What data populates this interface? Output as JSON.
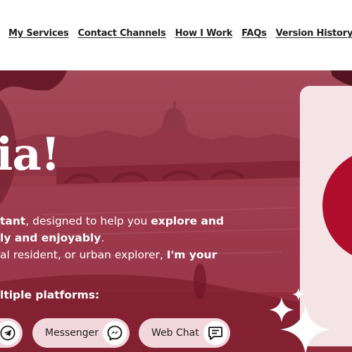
{
  "nav": {
    "items": [
      {
        "label": "My Services"
      },
      {
        "label": "Contact Channels"
      },
      {
        "label": "How I Work"
      },
      {
        "label": "FAQs"
      },
      {
        "label": "Version History"
      }
    ]
  },
  "hero": {
    "title": "ia!",
    "intro": {
      "l1a": "tant",
      "l1b": ", designed to help you ",
      "l1c": "explore and",
      "l2a": "ly and enjoyably",
      "l2b": ".",
      "l3a": "al resident, or urban explorer, ",
      "l3b": "I'm your"
    },
    "platforms_label": "ltiple platforms:",
    "buttons": [
      {
        "label": "",
        "icon": "telegram-icon"
      },
      {
        "label": "Messenger",
        "icon": "messenger-icon"
      },
      {
        "label": "Web Chat",
        "icon": "chat-icon"
      }
    ]
  },
  "colors": {
    "hero_overlay": "#9a3346",
    "button_bg": "#f2d7dc",
    "panel_bg": "#f4e4e6",
    "accent_red": "#b00d2c"
  }
}
